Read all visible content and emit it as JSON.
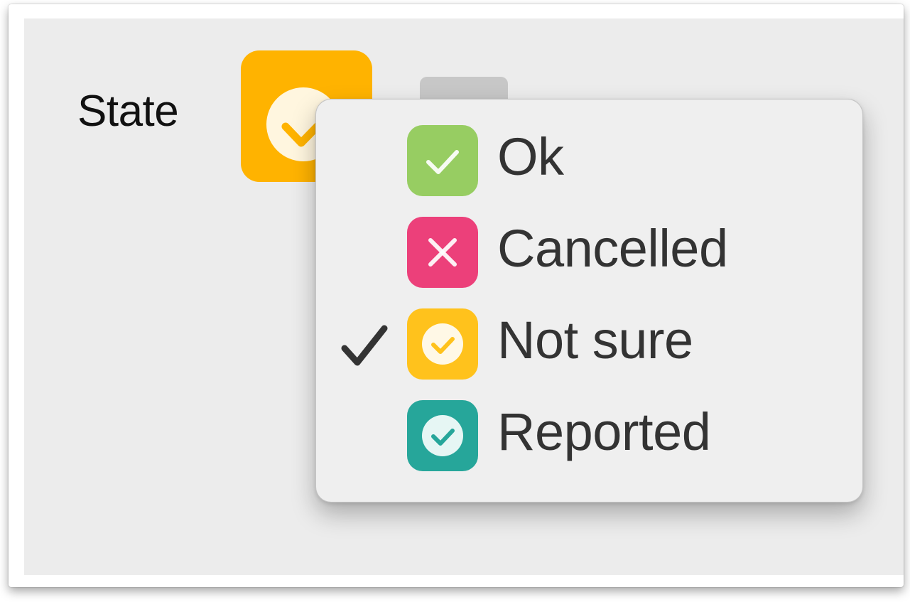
{
  "form": {
    "state_label": "State",
    "state_button": {
      "icon": "not-sure-icon",
      "color": "#ffb300"
    },
    "stepper": {
      "icon": "stepper-icon",
      "color": "#c7c7c7"
    }
  },
  "menu": {
    "selected": "Not sure",
    "check_glyph": "check-icon",
    "items": [
      {
        "label": "Ok",
        "icon": "ok-icon",
        "color": "#97cd62",
        "selected": false
      },
      {
        "label": "Cancelled",
        "icon": "cancel-icon",
        "color": "#ec407a",
        "selected": false
      },
      {
        "label": "Not sure",
        "icon": "not-sure-icon",
        "color": "#ffc21c",
        "selected": true
      },
      {
        "label": "Reported",
        "icon": "reported-icon",
        "color": "#26a69a",
        "selected": false
      }
    ]
  }
}
